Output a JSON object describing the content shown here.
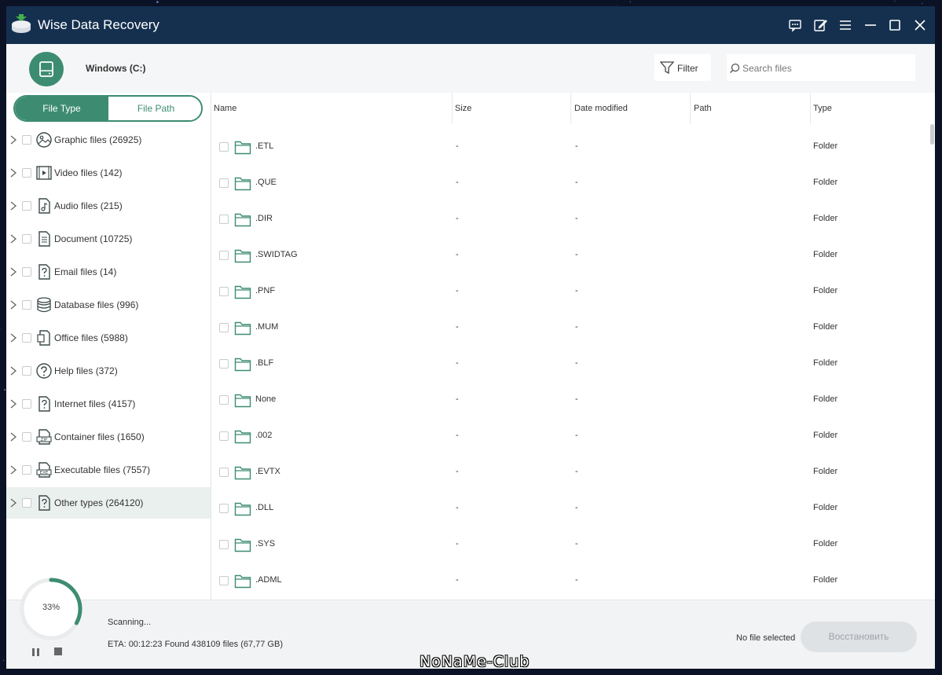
{
  "window": {
    "title": "Wise Data Recovery",
    "buttons": [
      "feedback-icon",
      "edit-icon",
      "menu-icon",
      "minimize-icon",
      "maximize-icon",
      "close-icon"
    ]
  },
  "topbar": {
    "drive_name": "Windows (C:)",
    "filter_label": "Filter",
    "search_placeholder": "Search files"
  },
  "sidebar": {
    "tabs": [
      {
        "label": "File Type",
        "active": true
      },
      {
        "label": "File Path",
        "active": false
      }
    ],
    "categories": [
      {
        "label": "Graphic files (26925)",
        "icon": "image-icon"
      },
      {
        "label": "Video files (142)",
        "icon": "video-icon"
      },
      {
        "label": "Audio files (215)",
        "icon": "audio-icon"
      },
      {
        "label": "Document (10725)",
        "icon": "document-icon"
      },
      {
        "label": "Email files (14)",
        "icon": "unknown-file-icon"
      },
      {
        "label": "Database files (996)",
        "icon": "database-icon"
      },
      {
        "label": "Office files (5988)",
        "icon": "office-icon"
      },
      {
        "label": "Help files (372)",
        "icon": "help-icon"
      },
      {
        "label": "Internet files (4157)",
        "icon": "unknown-file-icon"
      },
      {
        "label": "Container files (1650)",
        "icon": "zip-icon"
      },
      {
        "label": "Executable files (7557)",
        "icon": "exe-icon"
      },
      {
        "label": "Other types (264120)",
        "icon": "unknown-file-icon",
        "selected": true
      }
    ]
  },
  "table": {
    "columns": [
      "Name",
      "Size",
      "Date modified",
      "Path",
      "Type"
    ],
    "rows": [
      {
        "name": ".ETL",
        "size": "-",
        "date": "-",
        "path": "",
        "type": "Folder"
      },
      {
        "name": ".QUE",
        "size": "-",
        "date": "-",
        "path": "",
        "type": "Folder"
      },
      {
        "name": ".DIR",
        "size": "-",
        "date": "-",
        "path": "",
        "type": "Folder"
      },
      {
        "name": ".SWIDTAG",
        "size": "-",
        "date": "-",
        "path": "",
        "type": "Folder"
      },
      {
        "name": ".PNF",
        "size": "-",
        "date": "-",
        "path": "",
        "type": "Folder"
      },
      {
        "name": ".MUM",
        "size": "-",
        "date": "-",
        "path": "",
        "type": "Folder"
      },
      {
        "name": ".BLF",
        "size": "-",
        "date": "-",
        "path": "",
        "type": "Folder"
      },
      {
        "name": "None",
        "size": "-",
        "date": "-",
        "path": "",
        "type": "Folder"
      },
      {
        "name": ".002",
        "size": "-",
        "date": "-",
        "path": "",
        "type": "Folder"
      },
      {
        "name": ".EVTX",
        "size": "-",
        "date": "-",
        "path": "",
        "type": "Folder"
      },
      {
        "name": ".DLL",
        "size": "-",
        "date": "-",
        "path": "",
        "type": "Folder"
      },
      {
        "name": ".SYS",
        "size": "-",
        "date": "-",
        "path": "",
        "type": "Folder"
      },
      {
        "name": ".ADML",
        "size": "-",
        "date": "-",
        "path": "",
        "type": "Folder"
      }
    ]
  },
  "bottom": {
    "progress_value": 0.33,
    "progress_label": "33%",
    "scan_status": "Scanning...",
    "eta": "ETA: 00:12:23 Found 438109 files (67,77 GB)",
    "selection_status": "No file selected",
    "restore_label": "Восстановить"
  },
  "watermark": "NoNaMe-Club",
  "colors": {
    "accent": "#3d8c72",
    "titlebar": "#15304f",
    "selected_row": "#eaf0ee"
  }
}
